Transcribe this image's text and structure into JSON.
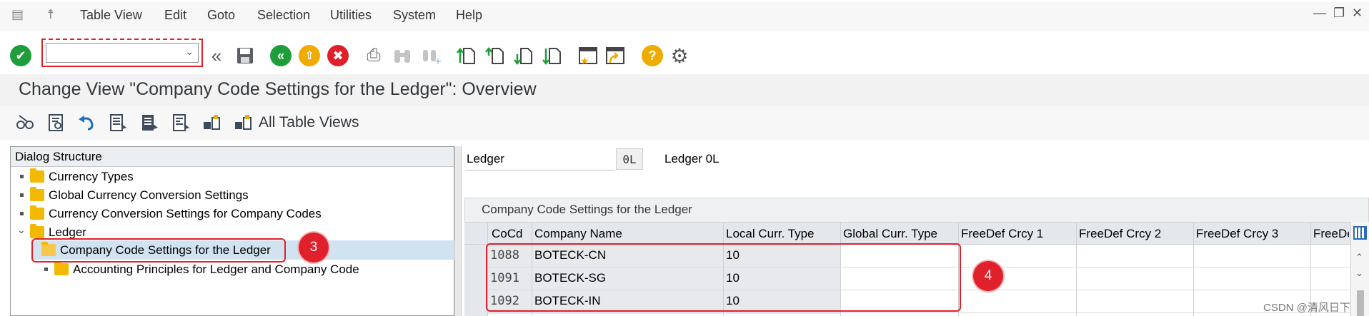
{
  "menu": {
    "items": [
      "Table View",
      "Edit",
      "Goto",
      "Selection",
      "Utilities",
      "System",
      "Help"
    ]
  },
  "toolbar": {
    "command_field": {
      "value": "",
      "placeholder": ""
    }
  },
  "page": {
    "title": "Change View \"Company Code Settings for the Ledger\": Overview"
  },
  "app_toolbar": {
    "all_table_views": "All Table Views"
  },
  "dialog_structure": {
    "header": "Dialog Structure",
    "items": [
      {
        "label": "Currency Types"
      },
      {
        "label": "Global Currency Conversion Settings"
      },
      {
        "label": "Currency Conversion Settings for Company Codes"
      },
      {
        "label": "Ledger"
      },
      {
        "label": "Company Code Settings for the Ledger"
      },
      {
        "label": "Accounting Principles for Ledger and Company Code"
      }
    ]
  },
  "ledger": {
    "label": "Ledger",
    "value": "0L",
    "description": "Ledger 0L"
  },
  "table": {
    "title": "Company Code Settings for the Ledger",
    "columns": [
      "CoCd",
      "Company Name",
      "Local Curr. Type",
      "Global Curr. Type",
      "FreeDef Crcy 1",
      "FreeDef Crcy 2",
      "FreeDef Crcy 3",
      "FreeDe"
    ],
    "rows": [
      {
        "cocd": "1088",
        "name": "BOTECK-CN",
        "local": "10"
      },
      {
        "cocd": "1091",
        "name": "BOTECK-SG",
        "local": "10"
      },
      {
        "cocd": "1092",
        "name": "BOTECK-IN",
        "local": "10"
      }
    ]
  },
  "callouts": {
    "tree": "3",
    "table": "4"
  },
  "watermark": "CSDN @清风日下",
  "colors": {
    "accent": "#e0202a",
    "ok": "#1e9e3a",
    "warn": "#f0ab00",
    "cancel": "#e0202a"
  }
}
